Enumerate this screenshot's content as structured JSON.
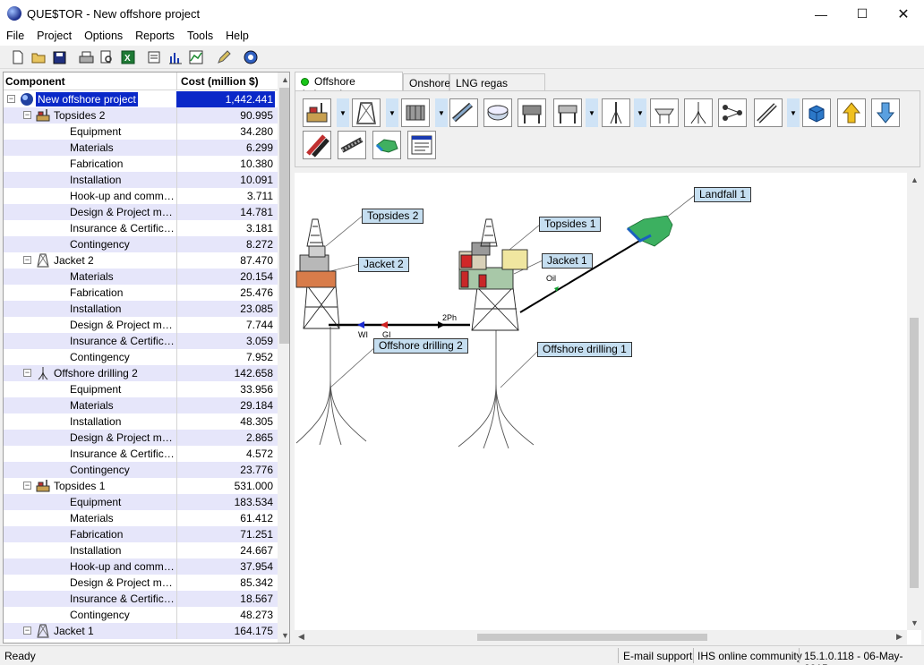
{
  "window": {
    "title": "QUE$TOR - New offshore project",
    "controls": [
      "minimize",
      "maximize",
      "close"
    ]
  },
  "menu": [
    "File",
    "Project",
    "Options",
    "Reports",
    "Tools",
    "Help"
  ],
  "toolbar_icons": [
    "new-icon",
    "open-icon",
    "save-icon",
    "print-icon",
    "print-preview-icon",
    "excel-icon",
    "properties-icon",
    "bar-chart-icon",
    "line-chart-icon",
    "edit-icon",
    "globe-help-icon"
  ],
  "tree": {
    "headers": {
      "component": "Component",
      "cost": "Cost (million $)"
    },
    "rows": [
      {
        "level": 0,
        "kind": "project",
        "name": "New offshore project",
        "cost": "1,442.441",
        "selected": true,
        "expanded": true
      },
      {
        "level": 1,
        "kind": "topsides",
        "name": "Topsides  2",
        "cost": "90.995",
        "expanded": true
      },
      {
        "level": 2,
        "kind": "item",
        "name": "Equipment",
        "cost": "34.280"
      },
      {
        "level": 2,
        "kind": "item",
        "name": "Materials",
        "cost": "6.299"
      },
      {
        "level": 2,
        "kind": "item",
        "name": "Fabrication",
        "cost": "10.380"
      },
      {
        "level": 2,
        "kind": "item",
        "name": "Installation",
        "cost": "10.091"
      },
      {
        "level": 2,
        "kind": "item",
        "name": "Hook-up and commissi...",
        "cost": "3.711"
      },
      {
        "level": 2,
        "kind": "item",
        "name": "Design & Project man...",
        "cost": "14.781"
      },
      {
        "level": 2,
        "kind": "item",
        "name": "Insurance & Certificat...",
        "cost": "3.181"
      },
      {
        "level": 2,
        "kind": "item",
        "name": "Contingency",
        "cost": "8.272"
      },
      {
        "level": 1,
        "kind": "jacket",
        "name": "Jacket  2",
        "cost": "87.470",
        "expanded": true
      },
      {
        "level": 2,
        "kind": "item",
        "name": "Materials",
        "cost": "20.154"
      },
      {
        "level": 2,
        "kind": "item",
        "name": "Fabrication",
        "cost": "25.476"
      },
      {
        "level": 2,
        "kind": "item",
        "name": "Installation",
        "cost": "23.085"
      },
      {
        "level": 2,
        "kind": "item",
        "name": "Design & Project man...",
        "cost": "7.744"
      },
      {
        "level": 2,
        "kind": "item",
        "name": "Insurance & Certificat...",
        "cost": "3.059"
      },
      {
        "level": 2,
        "kind": "item",
        "name": "Contingency",
        "cost": "7.952"
      },
      {
        "level": 1,
        "kind": "drilling",
        "name": "Offshore drilling  2",
        "cost": "142.658",
        "expanded": true
      },
      {
        "level": 2,
        "kind": "item",
        "name": "Equipment",
        "cost": "33.956"
      },
      {
        "level": 2,
        "kind": "item",
        "name": "Materials",
        "cost": "29.184"
      },
      {
        "level": 2,
        "kind": "item",
        "name": "Installation",
        "cost": "48.305"
      },
      {
        "level": 2,
        "kind": "item",
        "name": "Design & Project man...",
        "cost": "2.865"
      },
      {
        "level": 2,
        "kind": "item",
        "name": "Insurance & Certificat...",
        "cost": "4.572"
      },
      {
        "level": 2,
        "kind": "item",
        "name": "Contingency",
        "cost": "23.776"
      },
      {
        "level": 1,
        "kind": "topsides",
        "name": "Topsides  1",
        "cost": "531.000",
        "expanded": true
      },
      {
        "level": 2,
        "kind": "item",
        "name": "Equipment",
        "cost": "183.534"
      },
      {
        "level": 2,
        "kind": "item",
        "name": "Materials",
        "cost": "61.412"
      },
      {
        "level": 2,
        "kind": "item",
        "name": "Fabrication",
        "cost": "71.251"
      },
      {
        "level": 2,
        "kind": "item",
        "name": "Installation",
        "cost": "24.667"
      },
      {
        "level": 2,
        "kind": "item",
        "name": "Hook-up and commissi...",
        "cost": "37.954"
      },
      {
        "level": 2,
        "kind": "item",
        "name": "Design & Project man...",
        "cost": "85.342"
      },
      {
        "level": 2,
        "kind": "item",
        "name": "Insurance & Certificat...",
        "cost": "18.567"
      },
      {
        "level": 2,
        "kind": "item",
        "name": "Contingency",
        "cost": "48.273"
      },
      {
        "level": 1,
        "kind": "jacket",
        "name": "Jacket  1",
        "cost": "164.175",
        "expanded": true
      }
    ]
  },
  "tabs": [
    {
      "label": "Offshore (primary)",
      "active": true
    },
    {
      "label": "Onshore",
      "active": false
    },
    {
      "label": "LNG regas onshore",
      "active": false
    }
  ],
  "palette_icons": [
    "topsides-icon",
    "jacket-icon",
    "subsea-icon",
    "pipeline-icon",
    "fpso-icon",
    "jackup-icon",
    "tlp-icon",
    "spar-icon",
    "platform-icon",
    "drilling-icon",
    "manifold-icon",
    "riser-icon",
    "cube-icon",
    "up-arrow-icon",
    "down-arrow-icon",
    "pipes-icon",
    "girder-icon",
    "landfall-icon",
    "report-icon"
  ],
  "diagram": {
    "labels": {
      "topsides2": "Topsides  2",
      "jacket2": "Jacket  2",
      "topsides1": "Topsides  1",
      "jacket1": "Jacket  1",
      "landfall1": "Landfall  1",
      "drilling2": "Offshore drilling  2",
      "drilling1": "Offshore drilling  1"
    },
    "flows": {
      "wi": "WI",
      "gi": "GI",
      "twophase": "2Ph",
      "oil": "Oil"
    }
  },
  "status": {
    "ready": "Ready",
    "email": "E-mail support",
    "community": "IHS online community",
    "version": "15.1.0.118 - 06-May-2015"
  }
}
